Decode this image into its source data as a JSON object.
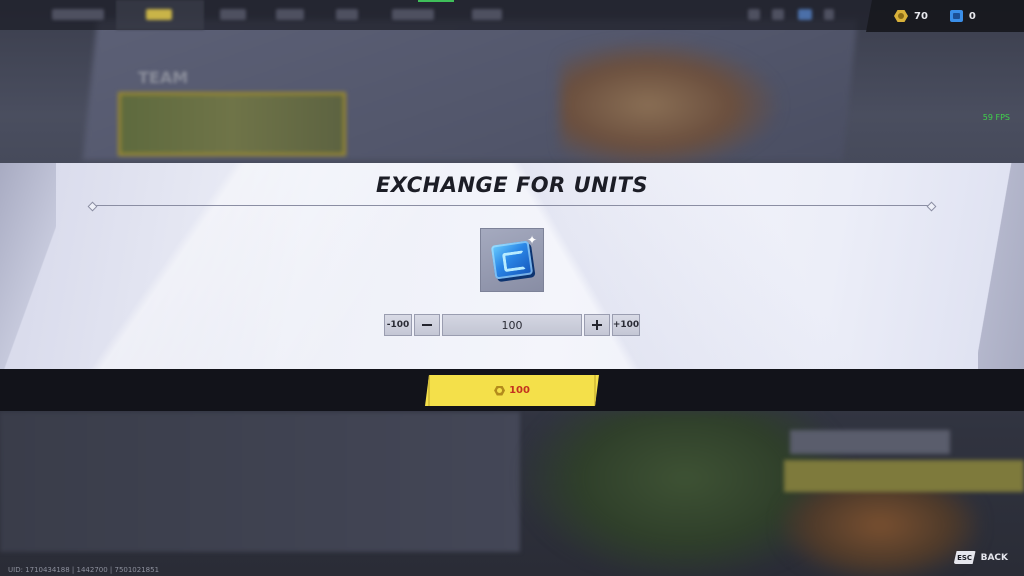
{
  "currency": {
    "coins": "70",
    "units": "0",
    "coin_icon": "lattice-coin-icon",
    "unit_icon": "unit-chip-icon"
  },
  "fps": "59 FPS",
  "modal": {
    "title": "EXCHANGE FOR UNITS",
    "item_icon": "unit-chip-icon",
    "quantity": "100",
    "minus100_label": "-100",
    "plus100_label": "+100",
    "confirm_cost": "100",
    "confirm_icon": "lattice-coin-icon"
  },
  "footer": {
    "esc_key": "ESC",
    "back_label": "BACK",
    "uid_text": "UID: 1710434188 | 1442700 | 7501021851"
  },
  "colors": {
    "accent_yellow": "#f4e04a",
    "cost_red": "#c4331f",
    "fps_green": "#3fd44a",
    "unit_blue": "#2a86e6",
    "coin_gold": "#d9b13a"
  }
}
